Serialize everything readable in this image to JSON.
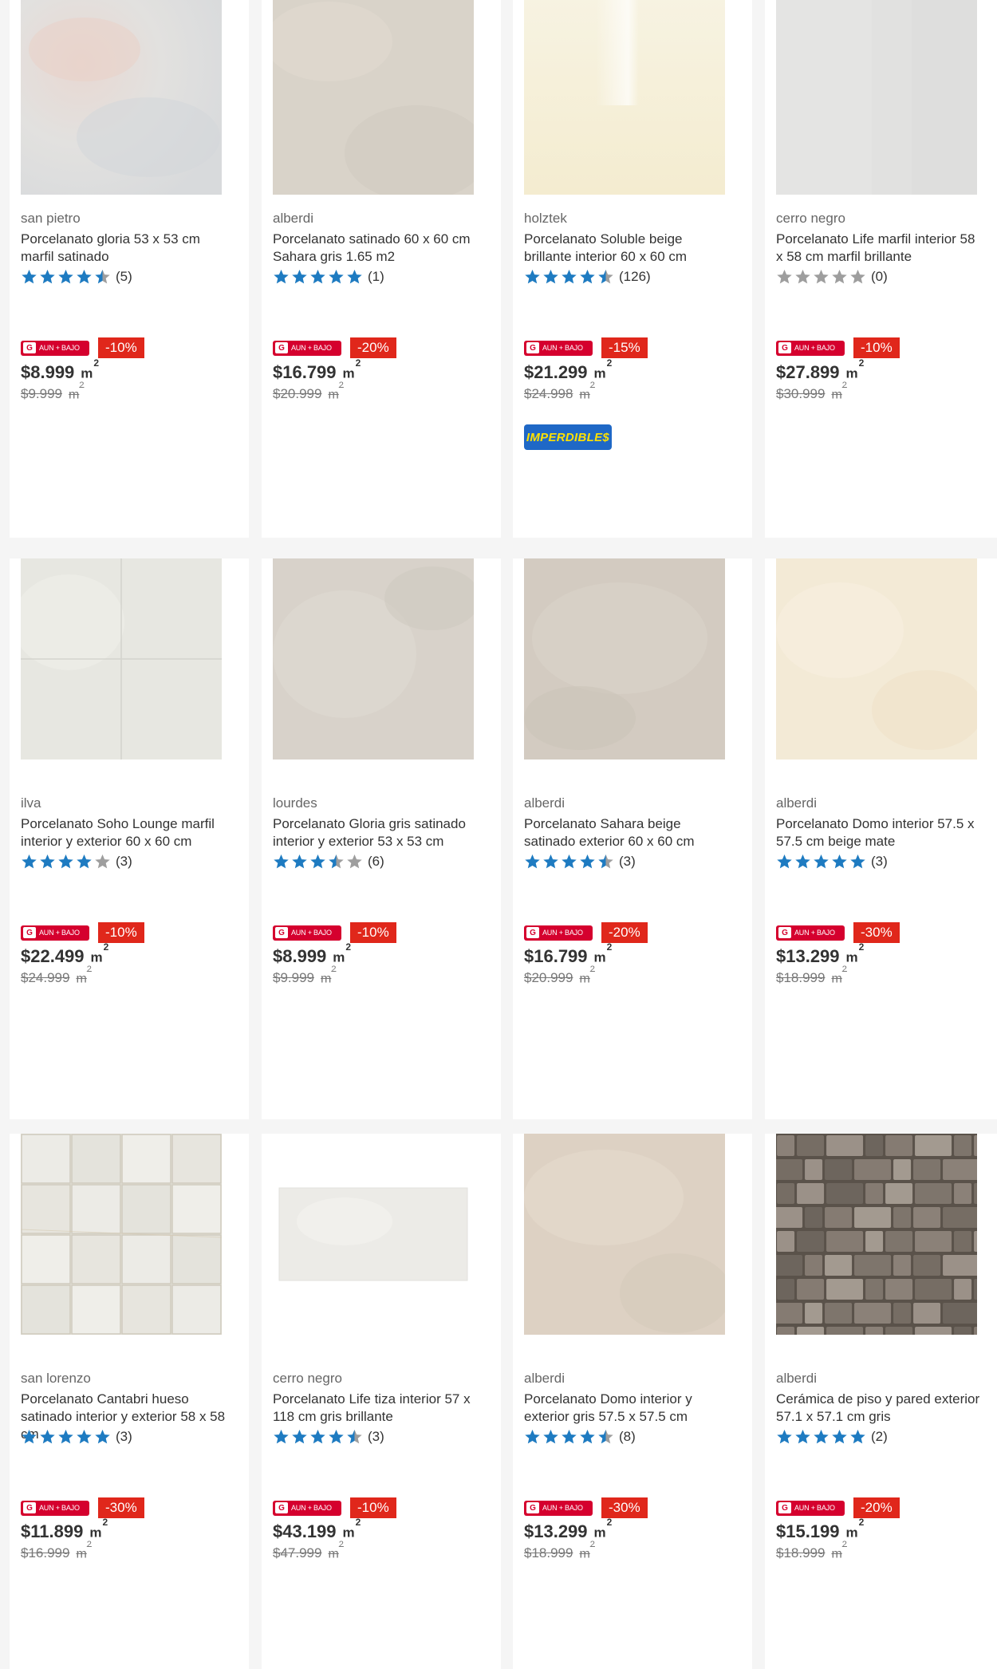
{
  "cmr_badge_text": "AUN + BAJO",
  "cmr_logo_glyph": "G",
  "colors": {
    "star_filled": "#1e7bc1",
    "star_empty": "#9e9e9e",
    "discount_bg": "#e0271b",
    "cmr_bg": "#d5002e",
    "imperdible_bg": "#1f68c6",
    "imperdible_text": "#ffe100"
  },
  "products": [
    {
      "brand": "san pietro",
      "title": "Porcelanato gloria 53 x 53 cm marfil satinado",
      "rating": 4.5,
      "reviews": "(5)",
      "discount": "-10%",
      "price": "$8.999",
      "unit": "m",
      "unit_exp": "2",
      "old_price": "$9.999",
      "image": "tile-light-grey-pink",
      "extra_badge": ""
    },
    {
      "brand": "alberdi",
      "title": "Porcelanato satinado 60 x 60 cm Sahara gris 1.65 m2",
      "rating": 5,
      "reviews": "(1)",
      "discount": "-20%",
      "price": "$16.799",
      "unit": "m",
      "unit_exp": "2",
      "old_price": "$20.999",
      "image": "tile-beige-grey",
      "extra_badge": ""
    },
    {
      "brand": "holztek",
      "title": "Porcelanato Soluble beige brillante interior 60 x 60 cm",
      "rating": 4.5,
      "reviews": "(126)",
      "discount": "-15%",
      "price": "$21.299",
      "unit": "m",
      "unit_exp": "2",
      "old_price": "$24.998",
      "image": "tile-cream-glossy",
      "extra_badge": "IMPERDIBLE$"
    },
    {
      "brand": "cerro negro",
      "title": "Porcelanato Life marfil interior 58 x 58 cm marfil brillante",
      "rating": 0,
      "reviews": "(0)",
      "discount": "-10%",
      "price": "$27.899",
      "unit": "m",
      "unit_exp": "2",
      "old_price": "$30.999",
      "image": "tile-light-grey",
      "extra_badge": ""
    },
    {
      "brand": "ilva",
      "title": "Porcelanato Soho Lounge marfil interior y exterior 60 x 60 cm",
      "rating": 4,
      "reviews": "(3)",
      "discount": "-10%",
      "price": "$22.499",
      "unit": "m",
      "unit_exp": "2",
      "old_price": "$24.999",
      "image": "tile-ivory-quad",
      "extra_badge": ""
    },
    {
      "brand": "lourdes",
      "title": "Porcelanato Gloria gris satinado interior y exterior 53 x 53 cm",
      "rating": 3.5,
      "reviews": "(6)",
      "discount": "-10%",
      "price": "$8.999",
      "unit": "m",
      "unit_exp": "2",
      "old_price": "$9.999",
      "image": "tile-greige",
      "extra_badge": ""
    },
    {
      "brand": "alberdi",
      "title": "Porcelanato Sahara beige satinado exterior 60 x 60 cm",
      "rating": 4.5,
      "reviews": "(3)",
      "discount": "-20%",
      "price": "$16.799",
      "unit": "m",
      "unit_exp": "2",
      "old_price": "$20.999",
      "image": "tile-taupe",
      "extra_badge": ""
    },
    {
      "brand": "alberdi",
      "title": "Porcelanato Domo interior 57.5 x 57.5 cm beige mate",
      "rating": 5,
      "reviews": "(3)",
      "discount": "-30%",
      "price": "$13.299",
      "unit": "m",
      "unit_exp": "2",
      "old_price": "$18.999",
      "image": "tile-cream-matte",
      "extra_badge": ""
    },
    {
      "brand": "san lorenzo",
      "title": "Porcelanato Cantabri hueso satinado interior y exterior 58 x 58 cm",
      "rating": 5,
      "reviews": "(3)",
      "discount": "-30%",
      "price": "$11.899",
      "unit": "m",
      "unit_exp": "2",
      "old_price": "$16.999",
      "image": "tile-bone-grid",
      "extra_badge": ""
    },
    {
      "brand": "cerro negro",
      "title": "Porcelanato Life tiza interior 57 x 118 cm gris brillante",
      "rating": 4.5,
      "reviews": "(3)",
      "discount": "-10%",
      "price": "$43.199",
      "unit": "m",
      "unit_exp": "2",
      "old_price": "$47.999",
      "image": "tile-white-plank",
      "extra_badge": ""
    },
    {
      "brand": "alberdi",
      "title": "Porcelanato Domo interior y exterior gris 57.5 x 57.5 cm",
      "rating": 4.5,
      "reviews": "(8)",
      "discount": "-30%",
      "price": "$13.299",
      "unit": "m",
      "unit_exp": "2",
      "old_price": "$18.999",
      "image": "tile-sand",
      "extra_badge": ""
    },
    {
      "brand": "alberdi",
      "title": "Cerámica de piso y pared exterior 57.1 x 57.1 cm gris",
      "rating": 5,
      "reviews": "(2)",
      "discount": "-20%",
      "price": "$15.199",
      "unit": "m",
      "unit_exp": "2",
      "old_price": "$18.999",
      "image": "tile-stone-pattern",
      "extra_badge": ""
    }
  ]
}
